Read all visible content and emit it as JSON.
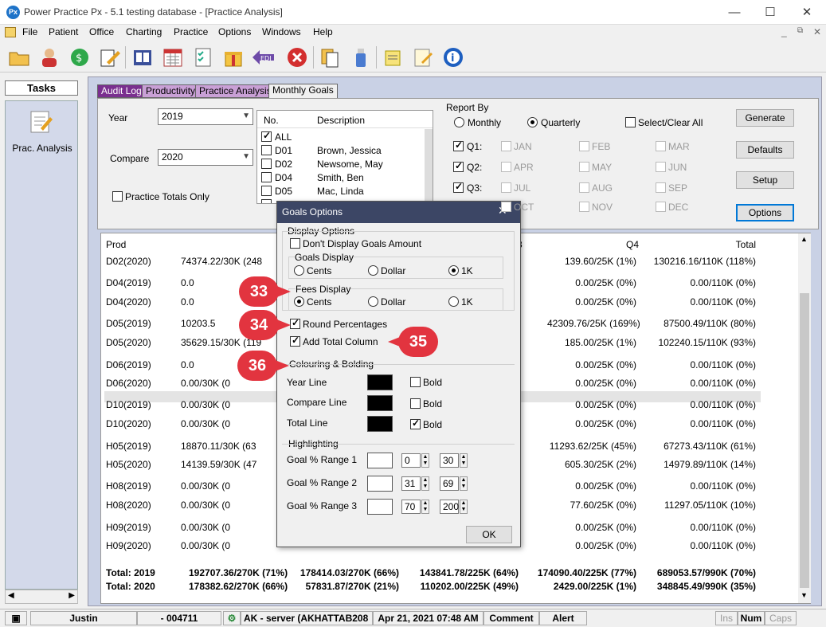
{
  "window": {
    "title": "Power Practice Px - 5.1 testing database - [Practice Analysis]",
    "icon_text": "Px"
  },
  "menu": [
    "File",
    "Patient",
    "Office",
    "Charting",
    "Practice",
    "Options",
    "Windows",
    "Help"
  ],
  "toolbar_icons": [
    "open-folder-icon",
    "patients-icon",
    "sync-icon",
    "edit-pen-icon",
    "book-icon",
    "calendar-icon",
    "checklist-icon",
    "gift-box-icon",
    "edi-icon",
    "close-red-icon",
    "documents-icon",
    "bottle-icon",
    "notes-icon",
    "notepad-icon",
    "help-circle-icon"
  ],
  "tasks": {
    "header": "Tasks",
    "item_label": "Prac. Analysis"
  },
  "tabs": [
    "Audit Log",
    "Productivity",
    "Practice Analysis",
    "Monthly Goals"
  ],
  "filters": {
    "year_label": "Year",
    "year_value": "2019",
    "compare_label": "Compare",
    "compare_value": "2020",
    "practice_totals_label": "Practice Totals Only",
    "list_headers": [
      "No.",
      "Description"
    ],
    "providers": [
      {
        "no": "ALL",
        "desc": "",
        "checked": true
      },
      {
        "no": "D01",
        "desc": "Brown, Jessica",
        "checked": false
      },
      {
        "no": "D02",
        "desc": "Newsome, May",
        "checked": false
      },
      {
        "no": "D04",
        "desc": "Smith, Ben",
        "checked": false
      },
      {
        "no": "D05",
        "desc": "Mac, Linda",
        "checked": false
      }
    ],
    "report_by_label": "Report By",
    "monthly_label": "Monthly",
    "quarterly_label": "Quarterly",
    "select_clear_label": "Select/Clear All",
    "quarters": [
      "Q1:",
      "Q2:",
      "Q3:"
    ],
    "months_col1": [
      "JAN",
      "APR",
      "JUL",
      "OCT"
    ],
    "months_col2": [
      "FEB",
      "MAY",
      "AUG",
      "NOV"
    ],
    "months_col3": [
      "MAR",
      "JUN",
      "SEP",
      "DEC"
    ]
  },
  "buttons": {
    "generate": "Generate",
    "defaults": "Defaults",
    "setup": "Setup",
    "options": "Options"
  },
  "grid": {
    "headers": {
      "prod": "Prod",
      "q4": "Q4",
      "total": "Total"
    },
    "rows": [
      {
        "prod": "D02(2020)",
        "q1": "74374.22/30K (248",
        "q4": "139.60/25K (1%)",
        "total": "130216.16/110K (118%)"
      },
      {
        "prod": "D04(2019)",
        "q1": "0.0",
        "q4": "0.00/25K (0%)",
        "total": "0.00/110K (0%)"
      },
      {
        "prod": "D04(2020)",
        "q1": "0.0",
        "q4": "0.00/25K (0%)",
        "total": "0.00/110K (0%)"
      },
      {
        "prod": "D05(2019)",
        "q1": "10203.5",
        "q4": "42309.76/25K (169%)",
        "total": "87500.49/110K (80%)"
      },
      {
        "prod": "D05(2020)",
        "q1": "35629.15/30K (119",
        "q4": "185.00/25K (1%)",
        "total": "102240.15/110K (93%)"
      },
      {
        "prod": "D06(2019)",
        "q1": "0.0",
        "q4": "0.00/25K (0%)",
        "total": "0.00/110K (0%)"
      },
      {
        "prod": "D06(2020)",
        "q1": "0.00/30K (0",
        "q4": "0.00/25K (0%)",
        "total": "0.00/110K (0%)"
      },
      {
        "prod": "D10(2019)",
        "q1": "0.00/30K (0",
        "q4": "0.00/25K (0%)",
        "total": "0.00/110K (0%)"
      },
      {
        "prod": "D10(2020)",
        "q1": "0.00/30K (0",
        "q4": "0.00/25K (0%)",
        "total": "0.00/110K (0%)"
      },
      {
        "prod": "H05(2019)",
        "q1": "18870.11/30K (63",
        "q4": "11293.62/25K (45%)",
        "total": "67273.43/110K (61%)"
      },
      {
        "prod": "H05(2020)",
        "q1": "14139.59/30K (47",
        "q4": "605.30/25K (2%)",
        "total": "14979.89/110K (14%)"
      },
      {
        "prod": "H08(2019)",
        "q1": "0.00/30K (0",
        "q4": "0.00/25K (0%)",
        "total": "0.00/110K (0%)"
      },
      {
        "prod": "H08(2020)",
        "q1": "0.00/30K (0",
        "q4": "77.60/25K (0%)",
        "total": "11297.05/110K (10%)"
      },
      {
        "prod": "H09(2019)",
        "q1": "0.00/30K (0",
        "q4": "0.00/25K (0%)",
        "total": "0.00/110K (0%)"
      },
      {
        "prod": "H09(2020)",
        "q1": "0.00/30K (0",
        "q4": "0.00/25K (0%)",
        "total": "0.00/110K (0%)"
      }
    ],
    "q3_header_fragment": "3",
    "totals": [
      {
        "label": "Total: 2019",
        "q1": "192707.36/270K (71%)",
        "q2": "178414.03/270K (66%)",
        "q3": "143841.78/225K (64%)",
        "q4": "174090.40/225K (77%)",
        "total": "689053.57/990K (70%)"
      },
      {
        "label": "Total: 2020",
        "q1": "178382.62/270K (66%)",
        "q2": "57831.87/270K (21%)",
        "q3": "110202.00/225K (49%)",
        "q4": "2429.00/225K (1%)",
        "total": "348845.49/990K (35%)"
      }
    ]
  },
  "dialog": {
    "title": "Goals Options",
    "display_options_label": "Display Options",
    "dont_display_label": "Don't Display Goals Amount",
    "goals_display_label": "Goals Display",
    "fees_display_label": "Fees Display",
    "cents": "Cents",
    "dollar": "Dollar",
    "one_k": "1K",
    "round_pct_label": "Round Percentages",
    "add_total_label": "Add Total Column",
    "colouring_label": "Colouring & Bolding",
    "year_line": "Year Line",
    "compare_line": "Compare Line",
    "total_line": "Total Line",
    "bold": "Bold",
    "highlighting_label": "Highlighting",
    "range1_label": "Goal % Range 1",
    "range1_from": "0",
    "range1_to": "30",
    "range2_label": "Goal % Range 2",
    "range2_from": "31",
    "range2_to": "69",
    "range3_label": "Goal % Range 3",
    "range3_from": "70",
    "range3_to": "200",
    "ok": "OK"
  },
  "callouts": [
    "33",
    "34",
    "35",
    "36"
  ],
  "status": {
    "user": "Justin",
    "id": "- 004711",
    "server": "AK - server (AKHATTAB208",
    "datetime": "Apr 21, 2021 07:48 AM",
    "comment": "Comment",
    "alert": "Alert",
    "ins": "Ins",
    "num": "Num",
    "caps": "Caps"
  },
  "colors": {
    "callout": "#e2343f",
    "dialog_title": "#3c4665",
    "main_bg": "#c9d1e5"
  }
}
